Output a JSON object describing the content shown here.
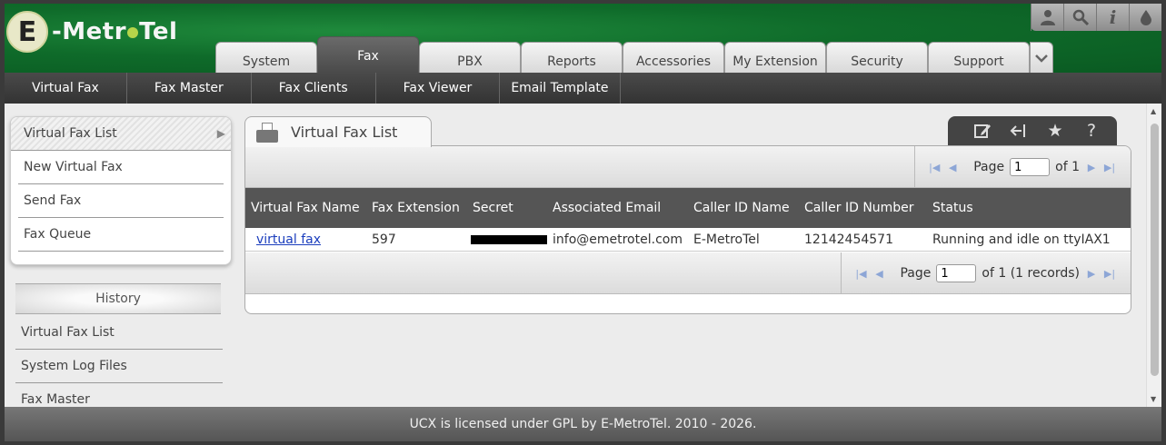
{
  "brand": {
    "logo_letter": "E",
    "logo_part1": "-Metr",
    "logo_part2": "Tel"
  },
  "top_icons": [
    "user-icon",
    "search-icon",
    "info-icon",
    "drop-icon"
  ],
  "main_tabs": [
    "System",
    "Fax",
    "PBX",
    "Reports",
    "Accessories",
    "My Extension",
    "Security",
    "Support"
  ],
  "active_main_tab": "Fax",
  "subnav": [
    "Virtual Fax",
    "Fax Master",
    "Fax Clients",
    "Fax Viewer",
    "Email Template"
  ],
  "left_menu": [
    "Virtual Fax List",
    "New Virtual Fax",
    "Send Fax",
    "Fax Queue"
  ],
  "history": {
    "title": "History",
    "items": [
      "Virtual Fax List",
      "System Log Files",
      "Fax Master"
    ]
  },
  "panel": {
    "title": "Virtual Fax List",
    "pager_top": {
      "label": "Page",
      "value": "1",
      "of": "of 1"
    },
    "pager_bottom": {
      "label": "Page",
      "value": "1",
      "of": "of 1 (1 records)"
    },
    "columns": [
      "Virtual Fax Name",
      "Fax Extension",
      "Secret",
      "Associated Email",
      "Caller ID Name",
      "Caller ID Number",
      "Status"
    ],
    "rows": [
      {
        "name": "virtual fax",
        "extension": "597",
        "secret": "",
        "email": "info@emetrotel.com",
        "caller_id_name": "E-MetroTel",
        "caller_id_number": "12142454571",
        "status": "Running and idle on ttyIAX1"
      }
    ]
  },
  "footer": "UCX is licensed under GPL by E-MetroTel. 2010 - 2026."
}
